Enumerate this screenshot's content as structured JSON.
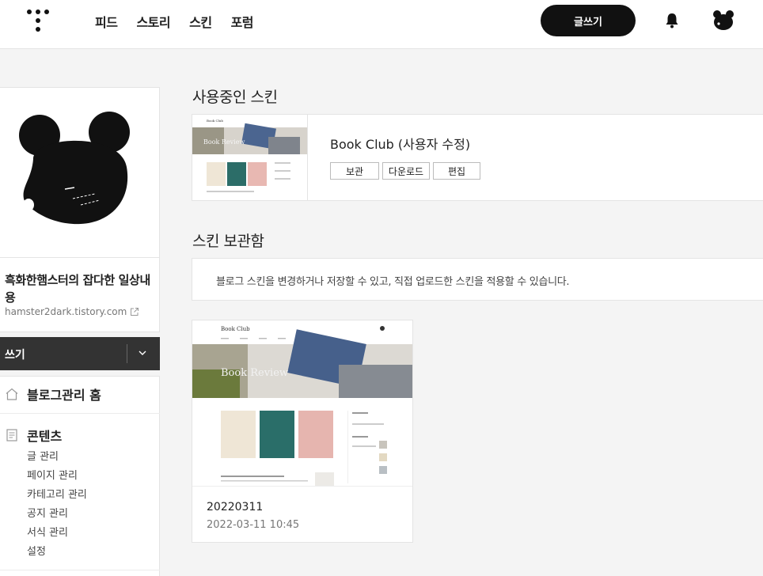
{
  "nav": {
    "items": [
      "피드",
      "스토리",
      "스킨",
      "포럼"
    ],
    "write_label": "글쓰기"
  },
  "profile": {
    "blog_name": "흑화한햄스터의 잡다한 일상내용",
    "blog_url": "hamster2dark.tistory.com"
  },
  "write_bar": {
    "label": "쓰기"
  },
  "menu": {
    "home": "블로그관리 홈",
    "content": "콘텐츠",
    "sub": [
      "글 관리",
      "페이지 관리",
      "카테고리 관리",
      "공지 관리",
      "서식 관리",
      "설정"
    ]
  },
  "current": {
    "title": "사용중인 스킨",
    "skin_name": "Book Club (사용자 수정)",
    "buttons": [
      "보관",
      "다운로드",
      "편집"
    ],
    "preview": {
      "header": "Book Club",
      "banner": "Book Review"
    }
  },
  "storage": {
    "title": "스킨 보관함",
    "info": "블로그 스킨을 변경하거나 저장할 수 있고, 직접 업로드한 스킨을 적용할 수 있습니다.",
    "items": [
      {
        "name": "20220311",
        "date": "2022-03-11 10:45",
        "preview": {
          "header": "Book Club",
          "banner": "Book Review"
        }
      }
    ]
  }
}
